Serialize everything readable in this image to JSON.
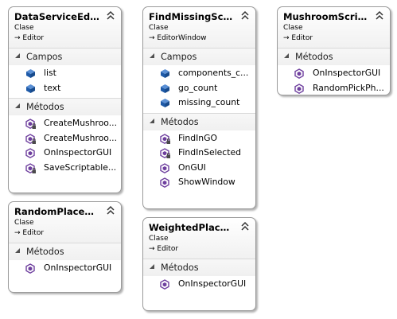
{
  "labels": {
    "stereotype": "Clase",
    "fields": "Campos",
    "methods": "Métodos"
  },
  "colors": {
    "method_icon": "#6e3f9e",
    "field_icon": "#1e5aa8",
    "border": "#9a9a9a"
  },
  "classes": {
    "data_service_editor": {
      "title": "DataServiceEditor",
      "base": "Editor",
      "fields": [
        {
          "name": "list",
          "icon": "field-icon"
        },
        {
          "name": "text",
          "icon": "field-icon"
        }
      ],
      "methods": [
        {
          "name": "CreateMushroo...",
          "icon": "private-method-icon"
        },
        {
          "name": "CreateMushroo...",
          "icon": "private-method-icon"
        },
        {
          "name": "OnInspectorGUI",
          "icon": "method-icon"
        },
        {
          "name": "SaveScriptable...",
          "icon": "private-method-icon"
        }
      ]
    },
    "find_missing_scripts": {
      "title": "FindMissingScri...",
      "base": "EditorWindow",
      "fields": [
        {
          "name": "components_c...",
          "icon": "field-icon"
        },
        {
          "name": "go_count",
          "icon": "field-icon"
        },
        {
          "name": "missing_count",
          "icon": "field-icon"
        }
      ],
      "methods": [
        {
          "name": "FindInGO",
          "icon": "private-method-icon"
        },
        {
          "name": "FindInSelected",
          "icon": "private-method-icon"
        },
        {
          "name": "OnGUI",
          "icon": "method-icon"
        },
        {
          "name": "ShowWindow",
          "icon": "method-icon"
        }
      ]
    },
    "mushroom_script": {
      "title": "MushroomScrip...",
      "base": "Editor",
      "methods": [
        {
          "name": "OnInspectorGUI",
          "icon": "method-icon"
        },
        {
          "name": "RandomPickPh...",
          "icon": "method-icon"
        }
      ]
    },
    "random_placement": {
      "title": "RandomPlacem...",
      "base": "Editor",
      "methods": [
        {
          "name": "OnInspectorGUI",
          "icon": "method-icon"
        }
      ]
    },
    "weighted_placement": {
      "title": "WeightedPlace...",
      "base": "Editor",
      "methods": [
        {
          "name": "OnInspectorGUI",
          "icon": "method-icon"
        }
      ]
    }
  }
}
